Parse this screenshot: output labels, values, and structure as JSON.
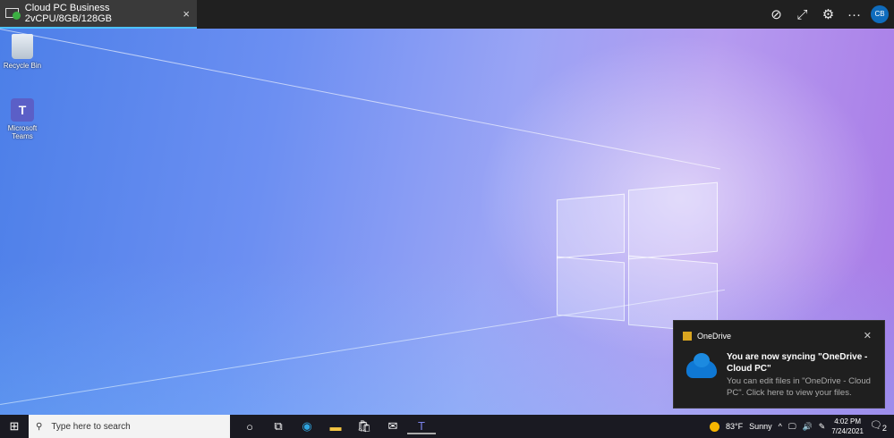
{
  "window": {
    "tab_title": "Cloud PC Business 2vCPU/8GB/128GB",
    "close": "×",
    "tools": {
      "pin": "⊘",
      "expand": "⤢",
      "settings": "⚙",
      "more": "···",
      "avatar": "CB"
    }
  },
  "desktop": {
    "icons": [
      {
        "label": "Recycle Bin"
      },
      {
        "label": "Microsoft Teams"
      }
    ]
  },
  "toast": {
    "app": "OneDrive",
    "close": "✕",
    "heading": "You are now syncing \"OneDrive - Cloud PC\"",
    "body": "You can edit files in \"OneDrive - Cloud PC\". Click here to view your files."
  },
  "taskbar": {
    "search_placeholder": "Type here to search",
    "weather_temp": "83°F",
    "weather_text": "Sunny",
    "time": "4:02 PM",
    "date": "7/24/2021",
    "notification_count": "2"
  }
}
